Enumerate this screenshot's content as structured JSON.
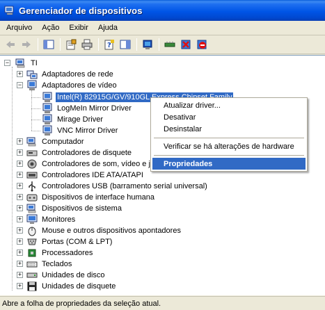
{
  "window": {
    "title": "Gerenciador de dispositivos"
  },
  "menu": [
    "Arquivo",
    "Ação",
    "Exibir",
    "Ajuda"
  ],
  "toolbar": [
    "back-icon",
    "forward-icon",
    "show-hide-tree-icon",
    "properties-icon",
    "print-icon",
    "help-icon",
    "details-view-icon",
    "scan-hardware-icon",
    "update-driver-icon",
    "uninstall-icon",
    "disable-icon"
  ],
  "tree": {
    "root": "TI",
    "categories": [
      {
        "label": "Adaptadores de rede",
        "icon": "network-adapter-icon",
        "expanded": false
      },
      {
        "label": "Adaptadores de vídeo",
        "icon": "display-adapter-icon",
        "expanded": true,
        "children": [
          {
            "label": "Intel(R) 82915G/GV/910GL Express Chipset Family",
            "selected": true
          },
          {
            "label": "LogMeIn Mirror Driver"
          },
          {
            "label": "Mirage Driver"
          },
          {
            "label": "VNC Mirror Driver"
          }
        ]
      },
      {
        "label": "Computador",
        "icon": "computer-icon",
        "expanded": false
      },
      {
        "label": "Controladores de disquete",
        "icon": "floppy-controller-icon",
        "expanded": false
      },
      {
        "label": "Controladores de som, vídeo e jogos",
        "icon": "sound-icon",
        "expanded": false
      },
      {
        "label": "Controladores IDE ATA/ATAPI",
        "icon": "ide-controller-icon",
        "expanded": false
      },
      {
        "label": "Controladores USB (barramento serial universal)",
        "icon": "usb-icon",
        "expanded": false
      },
      {
        "label": "Dispositivos de interface humana",
        "icon": "hid-icon",
        "expanded": false
      },
      {
        "label": "Dispositivos de sistema",
        "icon": "system-device-icon",
        "expanded": false
      },
      {
        "label": "Monitores",
        "icon": "monitor-icon",
        "expanded": false
      },
      {
        "label": "Mouse e outros dispositivos apontadores",
        "icon": "mouse-icon",
        "expanded": false
      },
      {
        "label": "Portas (COM & LPT)",
        "icon": "port-icon",
        "expanded": false
      },
      {
        "label": "Processadores",
        "icon": "processor-icon",
        "expanded": false
      },
      {
        "label": "Teclados",
        "icon": "keyboard-icon",
        "expanded": false
      },
      {
        "label": "Unidades de disco",
        "icon": "disk-drive-icon",
        "expanded": false
      },
      {
        "label": "Unidades de disquete",
        "icon": "floppy-drive-icon",
        "expanded": false
      }
    ]
  },
  "context_menu": {
    "items": [
      {
        "label": "Atualizar driver...",
        "highlighted": false
      },
      {
        "label": "Desativar",
        "highlighted": false
      },
      {
        "label": "Desinstalar",
        "highlighted": false
      },
      {
        "label": "Verificar se há alterações de hardware",
        "highlighted": false
      },
      {
        "label": "Propriedades",
        "highlighted": true
      }
    ]
  },
  "status": "Abre a folha de propriedades da seleção atual."
}
